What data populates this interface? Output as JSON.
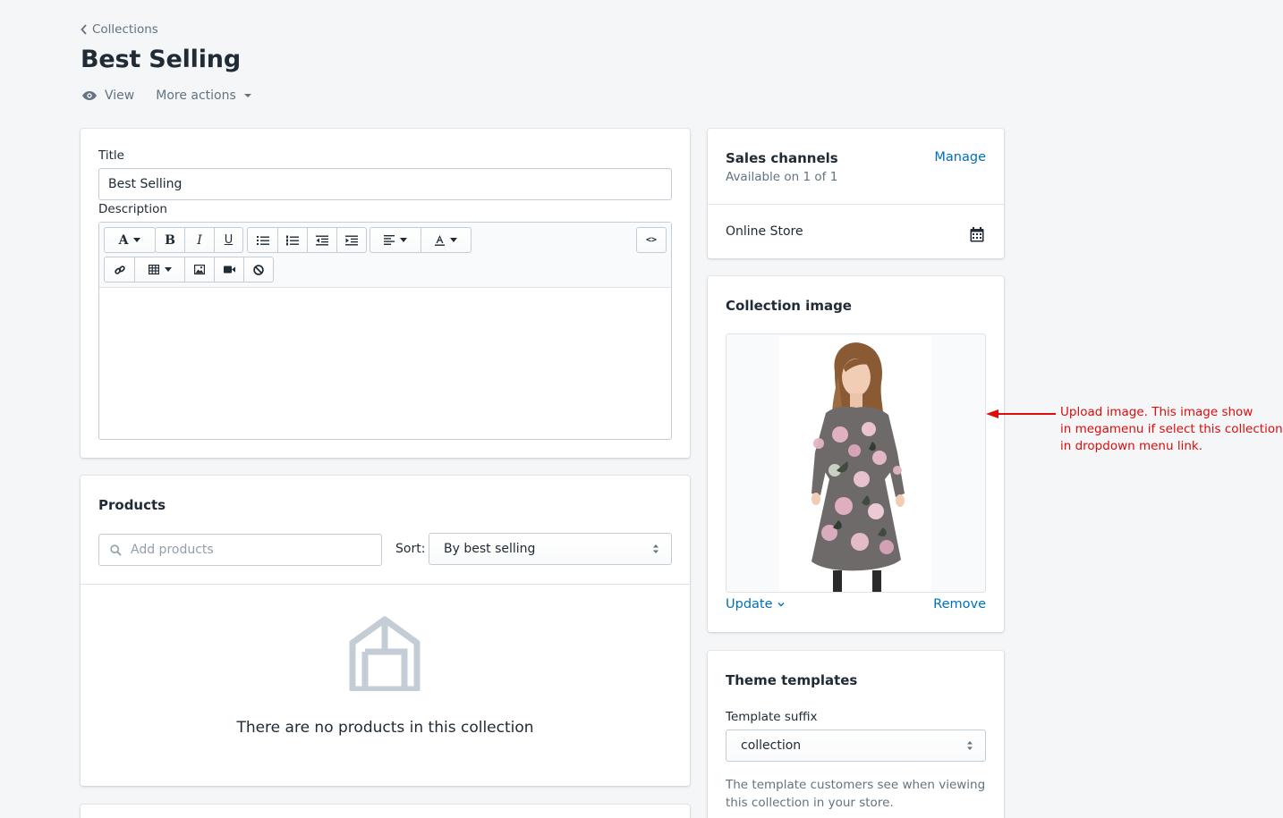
{
  "breadcrumb": {
    "label": "Collections"
  },
  "page": {
    "title": "Best Selling"
  },
  "actions": {
    "view": "View",
    "more": "More actions"
  },
  "title_card": {
    "title_label": "Title",
    "title_value": "Best Selling",
    "description_label": "Description",
    "toolbar": {
      "html_toggle": "<>"
    }
  },
  "products_card": {
    "heading": "Products",
    "search_placeholder": "Add products",
    "sort_label": "Sort:",
    "sort_value": "By best selling",
    "empty_text": "There are no products in this collection"
  },
  "sales_channels": {
    "heading": "Sales channels",
    "manage": "Manage",
    "availability": "Available on 1 of 1",
    "channel": "Online Store"
  },
  "collection_image": {
    "heading": "Collection image",
    "update": "Update",
    "remove": "Remove"
  },
  "theme_templates": {
    "heading": "Theme templates",
    "suffix_label": "Template suffix",
    "suffix_value": "collection",
    "help": "The template customers see when viewing this collection in your store."
  },
  "annotation": {
    "line1": "Upload image. This image show",
    "line2": "in megamenu if select this collection",
    "line3": "in dropdown menu link."
  },
  "colors": {
    "link": "#006fbb",
    "annotation": "#e00b0b",
    "background": "#f4f6f8"
  }
}
